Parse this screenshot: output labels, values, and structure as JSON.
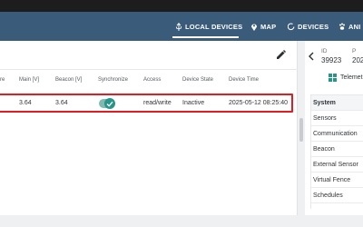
{
  "nav": {
    "items": [
      {
        "label": "LOCAL DEVICES",
        "icon": "usb-icon"
      },
      {
        "label": "MAP",
        "icon": "map-pin-icon"
      },
      {
        "label": "DEVICES",
        "icon": "circle-icon"
      },
      {
        "label": "ANI",
        "icon": "paw-icon"
      }
    ],
    "active_index": 0,
    "colors": {
      "bar": "#3b5b7a",
      "text": "#ffffff"
    }
  },
  "table": {
    "headers": [
      "re",
      "Main [V]",
      "Beacon [V]",
      "Synchronize",
      "Access",
      "Device State",
      "Device Time"
    ],
    "row": {
      "main_v": "3.64",
      "beacon_v": "3.64",
      "synchronize": true,
      "access": "read/write",
      "state": "Inactive",
      "time": "2025-05-12 08:25:40"
    },
    "highlight_color": "#e31b23"
  },
  "detail": {
    "id_label": "ID",
    "id_value": "39923",
    "col2_label": "P",
    "col2_value": "202",
    "telemetry_label": "Telemet",
    "accent": "#27958a"
  },
  "menu": {
    "items": [
      "System",
      "Sensors",
      "Communication",
      "Beacon",
      "External Sensor",
      "Virtual Fence",
      "Schedules"
    ],
    "active_index": 0
  }
}
